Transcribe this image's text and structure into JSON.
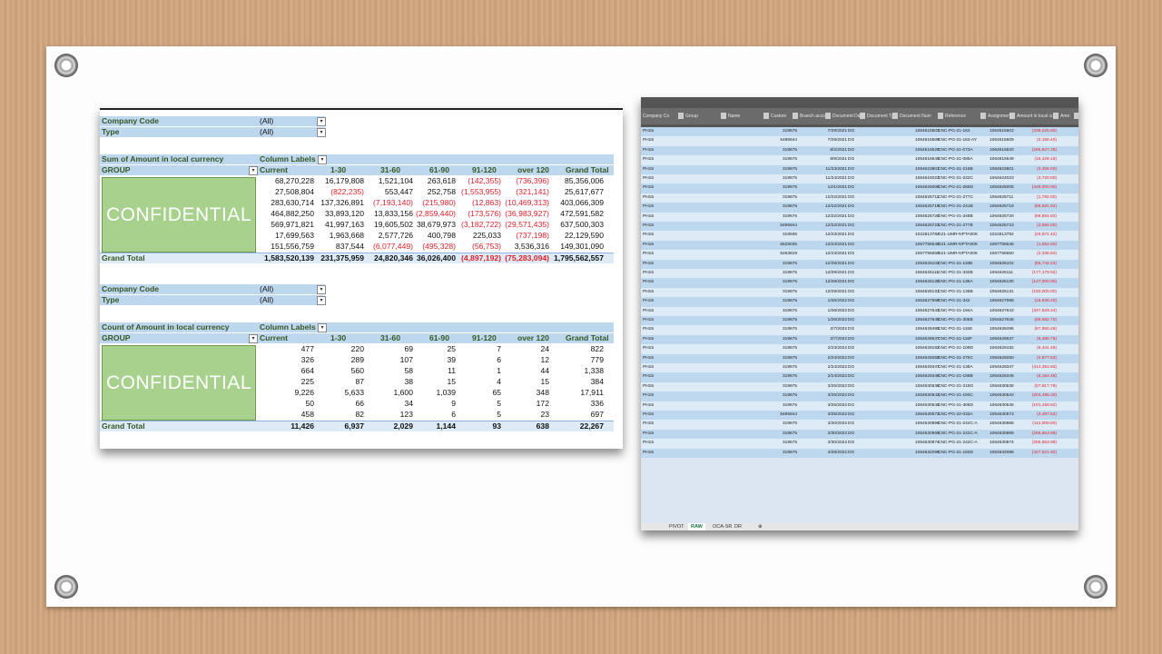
{
  "confidential_label": "CONFIDENTIAL",
  "pivot1": {
    "filters": [
      {
        "label": "Company Code",
        "value": "(All)"
      },
      {
        "label": "Type",
        "value": "(All)"
      }
    ],
    "value_label": "Sum of Amount in local currency",
    "column_labels": "Column Labels",
    "row_label": "GROUP",
    "columns": [
      "Current",
      "1-30",
      "31-60",
      "61-90",
      "91-120",
      "over 120",
      "Grand Total"
    ],
    "rows": [
      [
        "68,270,228",
        "16,179,808",
        "1,521,104",
        "263,618",
        "(142,355)",
        "(736,396)",
        "85,356,006"
      ],
      [
        "27,508,804",
        "(822,235)",
        "553,447",
        "252,758",
        "(1,553,955)",
        "(321,141)",
        "25,617,677"
      ],
      [
        "283,630,714",
        "137,326,891",
        "(7,193,140)",
        "(215,980)",
        "(12,863)",
        "(10,469,313)",
        "403,066,309"
      ],
      [
        "464,882,250",
        "33,893,120",
        "13,833,156",
        "(2,859,440)",
        "(173,576)",
        "(36,983,927)",
        "472,591,582"
      ],
      [
        "569,971,821",
        "41,997,163",
        "19,605,502",
        "38,679,973",
        "(3,182,722)",
        "(29,571,435)",
        "637,500,303"
      ],
      [
        "17,699,563",
        "1,963,668",
        "2,577,726",
        "400,798",
        "225,033",
        "(737,198)",
        "22,129,590"
      ],
      [
        "151,556,759",
        "837,544",
        "(6,077,449)",
        "(495,328)",
        "(56,753)",
        "3,536,316",
        "149,301,090"
      ]
    ],
    "grand_total_label": "Grand Total",
    "grand_total": [
      "1,583,520,139",
      "231,375,959",
      "24,820,346",
      "36,026,400",
      "(4,897,192)",
      "(75,283,094)",
      "1,795,562,557"
    ]
  },
  "pivot2": {
    "filters": [
      {
        "label": "Company Code",
        "value": "(All)"
      },
      {
        "label": "Type",
        "value": "(All)"
      }
    ],
    "value_label": "Count of Amount in local currency",
    "column_labels": "Column Labels",
    "row_label": "GROUP",
    "columns": [
      "Current",
      "1-30",
      "31-60",
      "61-90",
      "91-120",
      "over 120",
      "Grand Total"
    ],
    "rows": [
      [
        "477",
        "220",
        "69",
        "25",
        "7",
        "24",
        "822"
      ],
      [
        "326",
        "289",
        "107",
        "39",
        "6",
        "12",
        "779"
      ],
      [
        "664",
        "560",
        "58",
        "11",
        "1",
        "44",
        "1,338"
      ],
      [
        "225",
        "87",
        "38",
        "15",
        "4",
        "15",
        "384"
      ],
      [
        "9,226",
        "5,633",
        "1,600",
        "1,039",
        "65",
        "348",
        "17,911"
      ],
      [
        "50",
        "66",
        "34",
        "9",
        "5",
        "172",
        "336"
      ],
      [
        "458",
        "82",
        "123",
        "6",
        "5",
        "23",
        "697"
      ]
    ],
    "grand_total_label": "Grand Total",
    "grand_total": [
      "11,426",
      "6,937",
      "2,029",
      "1,144",
      "93",
      "638",
      "22,267"
    ]
  },
  "raw": {
    "headers": [
      "Company Co",
      "Group",
      "Name",
      "Custom",
      "Branch accou",
      "Document Da",
      "Document Ty",
      "Document Num",
      "Reference",
      "Assignment",
      "Amount in local currency",
      "Amo"
    ],
    "rows": [
      [
        "PH15",
        "319675",
        "7/29/2021",
        "DG",
        "1064615503",
        "CNC-PG-21-163",
        "1064615503",
        "(339,225.60)"
      ],
      [
        "PH15",
        "5495944",
        "7/29/2021",
        "DG",
        "1064615509",
        "CNC-PG-21-163-AY",
        "1064615509",
        "(2,150.40)"
      ],
      [
        "PH15",
        "319675",
        "8/2/2021",
        "DG",
        "1064616520",
        "CNC-PG-21-073A",
        "1064616520",
        "(285,827.25)"
      ],
      [
        "PH15",
        "319675",
        "8/9/2021",
        "DG",
        "1064616649",
        "CNC-PG-21-085A",
        "1064616649",
        "(15,429.16)"
      ],
      [
        "PH15",
        "319675",
        "11/23/2021",
        "DG",
        "1064623801",
        "CNC-PG-21-216B",
        "1064623801",
        "(3,456.00)"
      ],
      [
        "PH15",
        "319675",
        "11/24/2021",
        "DG",
        "1064624023",
        "CNC-PG-21-232C",
        "1064624023",
        "(3,720.00)"
      ],
      [
        "PH15",
        "319675",
        "12/1/2021",
        "DG",
        "1064625008",
        "CNC-PG-21-265D",
        "1064625008",
        "(448,000.00)"
      ],
      [
        "PH15",
        "319675",
        "12/22/2021",
        "DG",
        "1064625711",
        "CNC-PG-21-277C",
        "1064625711",
        "(1,792.00)"
      ],
      [
        "PH15",
        "319675",
        "12/22/2021",
        "DG",
        "1064625719",
        "CNC-PG-21-241B",
        "1064625719",
        "(86,591.92)"
      ],
      [
        "PH15",
        "319675",
        "12/22/2021",
        "DG",
        "1064625720",
        "CNC-PG-21-348B",
        "1064625720",
        "(86,591.92)"
      ],
      [
        "PH15",
        "5495944",
        "12/22/2021",
        "DG",
        "1064625723",
        "CNC-PG-21-277B",
        "1064625723",
        "(3,584.00)"
      ],
      [
        "PH15",
        "318936",
        "12/23/2021",
        "DG",
        "1022813782",
        "G21-UMR-NPTA006",
        "1022813782",
        "(26,571.42)"
      ],
      [
        "PH15",
        "5528035",
        "12/23/2021",
        "DG",
        "1067756548",
        "G21-UMR-NPTA006",
        "1067756548",
        "(1,552.50)"
      ],
      [
        "PH15",
        "5263819",
        "12/23/2021",
        "DG",
        "1067756550",
        "G21-UMR-NPTA006",
        "1067756550",
        "(2,338.84)"
      ],
      [
        "PH15",
        "319675",
        "12/28/2021",
        "DG",
        "1064626102",
        "CNC-PG-21-118B",
        "1064626102",
        "(56,742.24)"
      ],
      [
        "PH15",
        "319675",
        "12/29/2021",
        "DG",
        "1064626111",
        "CNC-PG-21-332B",
        "1064626111",
        "(177,178.52)"
      ],
      [
        "PH15",
        "319675",
        "12/29/2021",
        "DG",
        "1064626130",
        "CNC-PG-21-136A",
        "1064626130",
        "(147,000.00)"
      ],
      [
        "PH15",
        "319675",
        "12/29/2021",
        "DG",
        "1064626131",
        "CNC-PG-21-136B",
        "1064626131",
        "(192,000.00)"
      ],
      [
        "PH15",
        "319675",
        "1/26/2022",
        "DG",
        "1064627568",
        "CNC-PG-21-342",
        "1064627568",
        "(16,839.20)"
      ],
      [
        "PH15",
        "319675",
        "1/26/2022",
        "DG",
        "1064627643",
        "CNC-PG-21-194A",
        "1064627643",
        "(327,529.44)"
      ],
      [
        "PH15",
        "319675",
        "1/26/2022",
        "DG",
        "1064627648",
        "CNC-PG-21-306B",
        "1064627648",
        "(88,582.70)"
      ],
      [
        "PH15",
        "319675",
        "2/7/2022",
        "DG",
        "1064628495",
        "CNC-PG-21-115E",
        "1064628495",
        "(67,950.28)"
      ],
      [
        "PH15",
        "319675",
        "2/7/2022",
        "DG",
        "1064628637",
        "CNC-PG-21-115F",
        "1064628637",
        "(8,289.76)"
      ],
      [
        "PH15",
        "319675",
        "2/23/2022",
        "DG",
        "1064629182",
        "CNC-PG-21-109D",
        "1064629182",
        "(6,441.46)"
      ],
      [
        "PH15",
        "319675",
        "2/24/2022",
        "DG",
        "1064629250",
        "CNC-PG-21-275C",
        "1064629250",
        "(2,877.53)"
      ],
      [
        "PH15",
        "319675",
        "2/24/2022",
        "DG",
        "1064629347",
        "CNC-PG-21-138A",
        "1064629347",
        "(414,352.93)"
      ],
      [
        "PH15",
        "319675",
        "2/24/2022",
        "DG",
        "1064629348",
        "CNC-PG-21-196B",
        "1064629348",
        "(6,164.48)"
      ],
      [
        "PH15",
        "319675",
        "3/25/2022",
        "DG",
        "1064630538",
        "CNC-PG-21-219G",
        "1064630538",
        "(57,817.76)"
      ],
      [
        "PH15",
        "319675",
        "3/25/2022",
        "DG",
        "1064630543",
        "CNC-PG-21-193C",
        "1064630543",
        "(204,495.20)"
      ],
      [
        "PH15",
        "319675",
        "3/25/2022",
        "DG",
        "1064630545",
        "CNC-PG-21-305D",
        "1064630545",
        "(101,159.52)"
      ],
      [
        "PH15",
        "5495944",
        "3/25/2022",
        "DG",
        "1064630573",
        "CNC-PG-22-033A",
        "1064630573",
        "(3,487.52)"
      ],
      [
        "PH15",
        "319675",
        "3/30/2022",
        "DG",
        "1064630868",
        "CNC-PG-21-242C-A",
        "1064630868",
        "(112,000.00)"
      ],
      [
        "PH15",
        "319675",
        "3/30/2022",
        "DG",
        "1064630869",
        "CNC-PG-21-242C-A",
        "1064630869",
        "(255,653.89)"
      ],
      [
        "PH15",
        "319675",
        "3/30/2022",
        "DG",
        "1064630874",
        "CNC-PG-21-242C-A",
        "1064630874",
        "(255,653.89)"
      ],
      [
        "PH15",
        "319675",
        "4/28/2022",
        "DG",
        "1064632096",
        "CNC-PG-21-193D",
        "1064632096",
        "(427,521.92)"
      ]
    ],
    "tabs": [
      "PIVOT",
      "RAW",
      "OCA-SR",
      "DR"
    ],
    "active_tab": "RAW"
  },
  "colors": {
    "header_blue": "#bdd7ee",
    "header_text": "#375623",
    "negative": "#e0202a",
    "confidential_fill": "#a9d18e"
  }
}
